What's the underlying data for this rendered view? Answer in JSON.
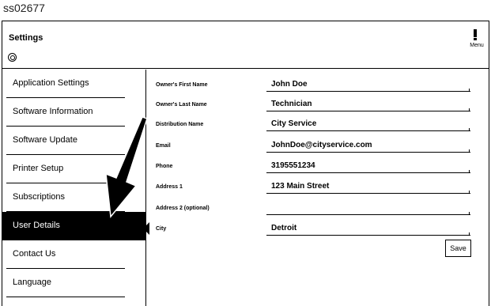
{
  "reference_id": "ss02677",
  "header": {
    "title": "Settings",
    "menu_label": "Menu"
  },
  "sidebar": {
    "items": [
      {
        "label": "Application Settings"
      },
      {
        "label": "Software Information"
      },
      {
        "label": "Software Update"
      },
      {
        "label": "Printer Setup"
      },
      {
        "label": "Subscriptions"
      },
      {
        "label": "User Details",
        "active": true
      },
      {
        "label": "Contact Us"
      },
      {
        "label": "Language"
      }
    ]
  },
  "form": {
    "fields": [
      {
        "label": "Owner's First Name",
        "value": "John Doe"
      },
      {
        "label": "Owner's Last Name",
        "value": "Technician"
      },
      {
        "label": "Distribution Name",
        "value": "City Service"
      },
      {
        "label": "Email",
        "value": "JohnDoe@cityservice.com"
      },
      {
        "label": "Phone",
        "value": "3195551234"
      },
      {
        "label": "Address 1",
        "value": "123 Main Street"
      },
      {
        "label": "Address 2 (optional)",
        "value": ""
      },
      {
        "label": "City",
        "value": "Detroit"
      }
    ],
    "save_label": "Save"
  },
  "colors": {
    "active_bg": "#000000",
    "active_text": "#ffffff"
  }
}
